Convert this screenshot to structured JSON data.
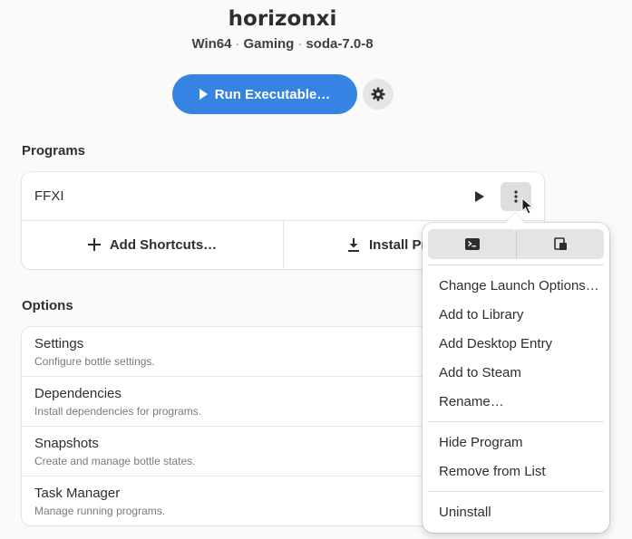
{
  "header": {
    "title": "horizonxi",
    "arch": "Win64",
    "environment": "Gaming",
    "runner": "soda-7.0-8",
    "separator": "·"
  },
  "actions": {
    "run_label": "Run Executable…"
  },
  "programs": {
    "section_label": "Programs",
    "items": [
      {
        "name": "FFXI"
      }
    ],
    "add_shortcuts_label": "Add Shortcuts…",
    "install_label": "Install Pro"
  },
  "options": {
    "section_label": "Options",
    "rows": [
      {
        "title": "Settings",
        "subtitle": "Configure bottle settings."
      },
      {
        "title": "Dependencies",
        "subtitle": "Install dependencies for programs."
      },
      {
        "title": "Snapshots",
        "subtitle": "Create and manage bottle states."
      },
      {
        "title": "Task Manager",
        "subtitle": "Manage running programs."
      }
    ]
  },
  "menu": {
    "icons": [
      "terminal-icon",
      "browse-files-icon"
    ],
    "items": [
      "Change Launch Options…",
      "Add to Library",
      "Add Desktop Entry",
      "Add to Steam",
      "Rename…",
      "Hide Program",
      "Remove from List",
      "Uninstall"
    ]
  },
  "colors": {
    "accent": "#3584e4",
    "background": "#fafafa"
  }
}
